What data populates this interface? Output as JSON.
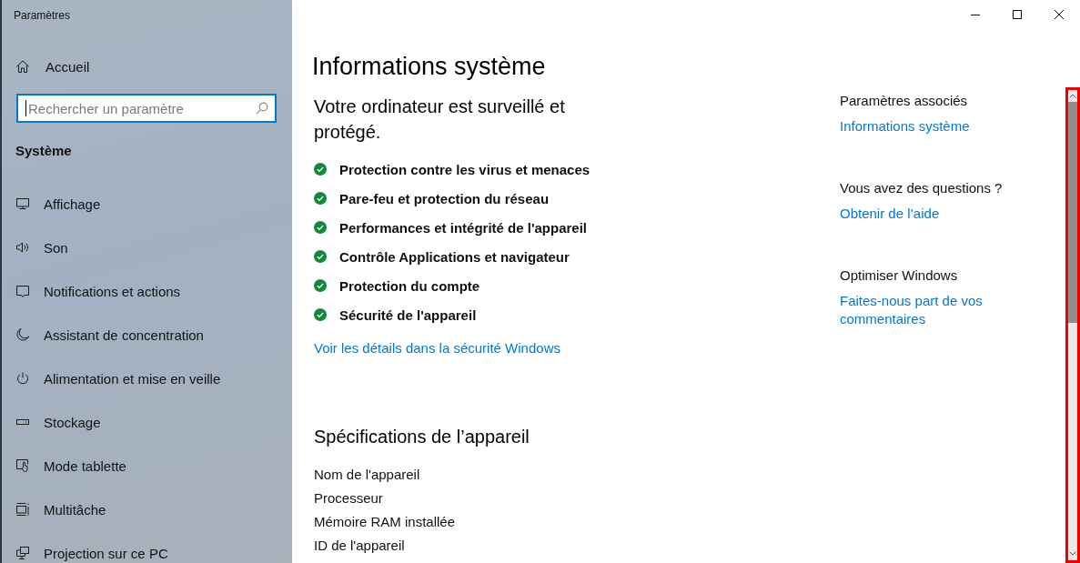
{
  "window": {
    "title": "Paramètres"
  },
  "sidebar": {
    "home": {
      "label": "Accueil"
    },
    "search": {
      "placeholder": "Rechercher un paramètre",
      "focused": true
    },
    "section_title": "Système",
    "items": [
      {
        "label": "Affichage",
        "selected": false
      },
      {
        "label": "Son",
        "selected": false
      },
      {
        "label": "Notifications et actions",
        "selected": false
      },
      {
        "label": "Assistant de concentration",
        "selected": false
      },
      {
        "label": "Alimentation et mise en veille",
        "selected": false
      },
      {
        "label": "Stockage",
        "selected": false
      },
      {
        "label": "Mode tablette",
        "selected": false
      },
      {
        "label": "Multitâche",
        "selected": false
      },
      {
        "label": "Projection sur ce PC",
        "selected": false
      }
    ]
  },
  "page": {
    "title": "Informations système"
  },
  "security": {
    "heading": "Votre ordinateur est surveillé et protégé.",
    "items": [
      {
        "label": "Protection contre les virus et menaces",
        "protected": true
      },
      {
        "label": "Pare-feu et protection du réseau",
        "protected": true
      },
      {
        "label": "Performances et intégrité de l'appareil",
        "protected": true
      },
      {
        "label": "Contrôle Applications et navigateur",
        "protected": true
      },
      {
        "label": "Protection du compte",
        "protected": true
      },
      {
        "label": "Sécurité de l'appareil",
        "protected": true
      }
    ],
    "link": "Voir les détails dans la sécurité Windows"
  },
  "specifications": {
    "heading": "Spécifications de l’appareil",
    "rows": [
      "Nom de l'appareil",
      "Processeur",
      "Mémoire RAM installée",
      "ID de l'appareil"
    ]
  },
  "related": [
    {
      "heading": "Paramètres associés",
      "link": "Informations système"
    },
    {
      "heading": "Vous avez des questions ?",
      "link": "Obtenir de l’aide"
    },
    {
      "heading": "Optimiser Windows",
      "link": "Faites-nous part de vos commentaires"
    }
  ],
  "scrollbar": {
    "highlighted": true
  }
}
